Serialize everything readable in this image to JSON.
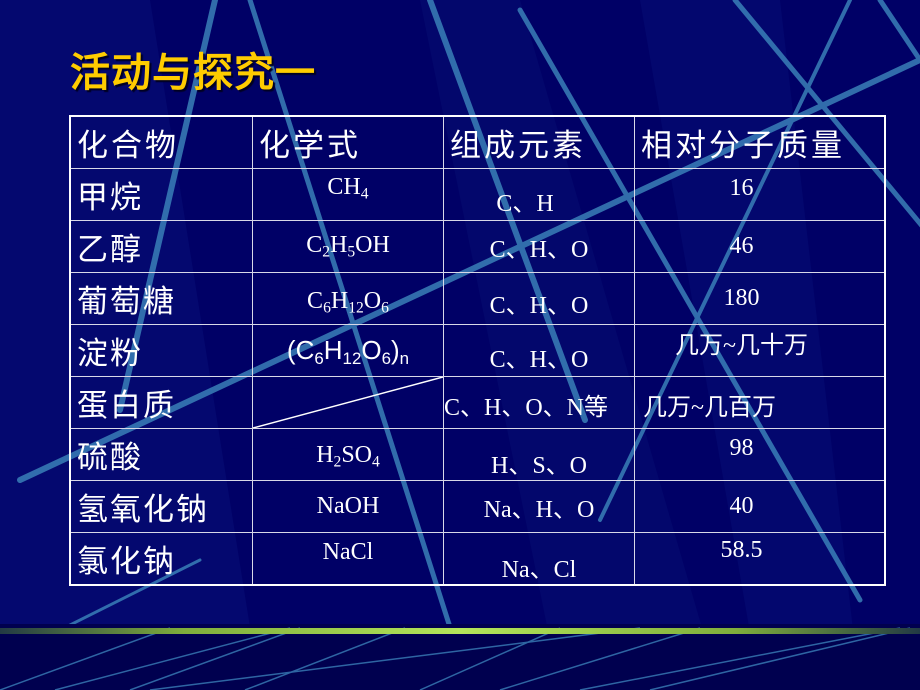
{
  "slide": {
    "title": "活动与探究一",
    "colors": {
      "background": "#000066",
      "title": "#ffcc00",
      "text": "#ffffff",
      "decor_lines": "#3a7fb8",
      "footer_bar": "#b4e65a"
    }
  },
  "table": {
    "headers": [
      "化合物",
      "化学式",
      "组成元素",
      "相对分子质量"
    ],
    "rows": [
      {
        "compound": "甲烷",
        "formula_parts": [
          [
            "CH",
            ""
          ],
          [
            "4",
            "sub"
          ]
        ],
        "elements": "C、H",
        "mass": "16"
      },
      {
        "compound": "乙醇",
        "formula_parts": [
          [
            "C",
            ""
          ],
          [
            "2",
            "sub"
          ],
          [
            "H",
            ""
          ],
          [
            "5",
            "sub"
          ],
          [
            "OH",
            ""
          ]
        ],
        "elements": "C、H、O",
        "mass": "46"
      },
      {
        "compound": "葡萄糖",
        "formula_parts": [
          [
            "C",
            ""
          ],
          [
            "6",
            "sub"
          ],
          [
            "H",
            ""
          ],
          [
            "12",
            "sub"
          ],
          [
            "O",
            ""
          ],
          [
            "6",
            "sub"
          ]
        ],
        "elements": "C、H、O",
        "mass": "180"
      },
      {
        "compound": "淀粉",
        "formula_parts": [
          [
            "(C",
            ""
          ],
          [
            "6",
            "sub"
          ],
          [
            "H",
            ""
          ],
          [
            "12",
            "sub"
          ],
          [
            "O",
            ""
          ],
          [
            "6",
            "sub"
          ],
          [
            ")",
            ""
          ],
          [
            "n",
            "sub"
          ]
        ],
        "elements": "C、H、O",
        "mass": "几万~几十万"
      },
      {
        "compound": "蛋白质",
        "formula_parts": [],
        "elements": "C、H、O、N等",
        "mass": "几万~几百万"
      },
      {
        "compound": "硫酸",
        "formula_parts": [
          [
            "H",
            ""
          ],
          [
            "2",
            "sub"
          ],
          [
            "SO",
            ""
          ],
          [
            "4",
            "sub"
          ]
        ],
        "elements": "H、S、O",
        "mass": "98"
      },
      {
        "compound": "氢氧化钠",
        "formula_parts": [
          [
            "NaOH",
            ""
          ]
        ],
        "elements": "Na、H、O",
        "mass": "40"
      },
      {
        "compound": "氯化钠",
        "formula_parts": [
          [
            "NaCl",
            ""
          ]
        ],
        "elements": "Na、Cl",
        "mass": "58.5"
      }
    ]
  }
}
